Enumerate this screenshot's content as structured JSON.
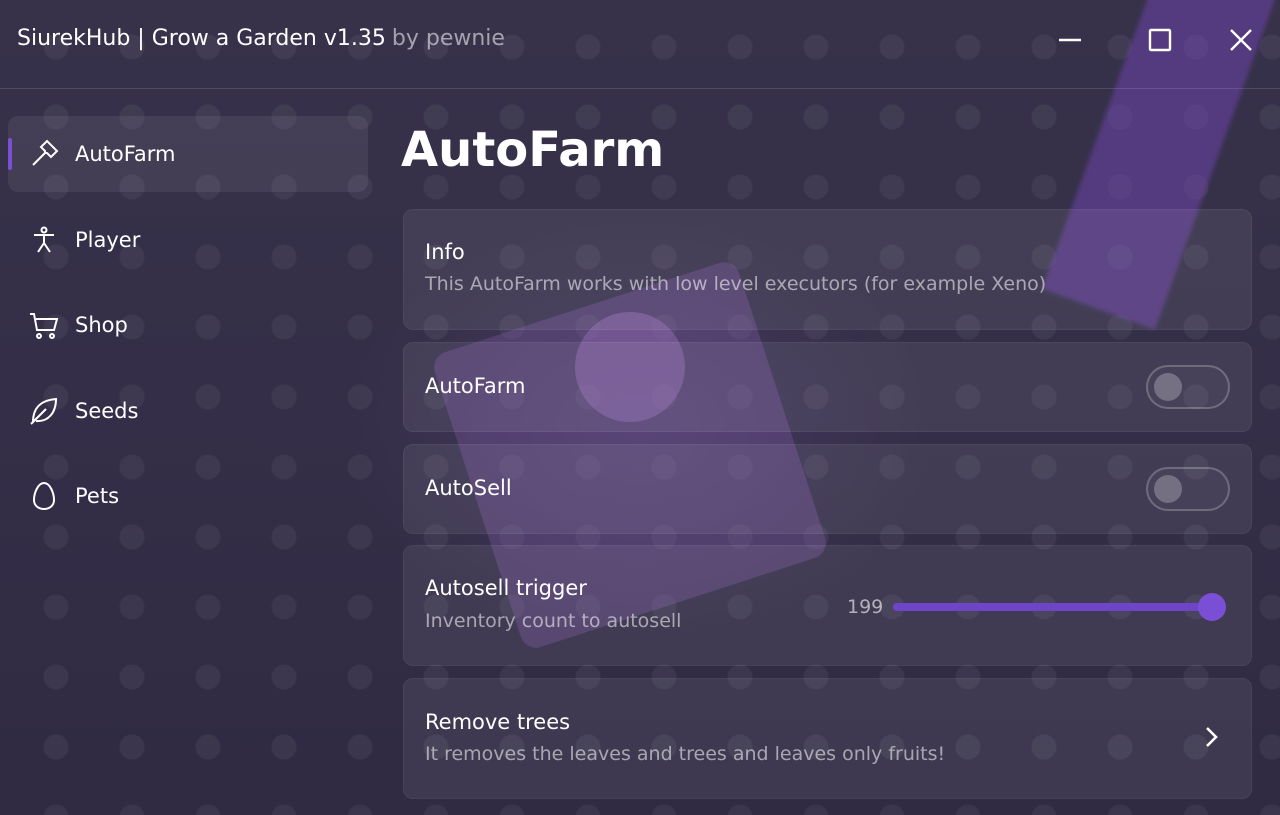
{
  "window": {
    "title": "SiurekHub | Grow a Garden v1.35",
    "author": "by pewnie",
    "controls": {
      "minimize_icon": "minimize-icon",
      "maximize_icon": "maximize-icon",
      "close_icon": "close-icon"
    }
  },
  "sidebar": {
    "items": [
      {
        "label": "AutoFarm",
        "icon": "hammer-icon",
        "active": true
      },
      {
        "label": "Player",
        "icon": "person-icon",
        "active": false
      },
      {
        "label": "Shop",
        "icon": "cart-icon",
        "active": false
      },
      {
        "label": "Seeds",
        "icon": "leaf-icon",
        "active": false
      },
      {
        "label": "Pets",
        "icon": "egg-icon",
        "active": false
      }
    ]
  },
  "main": {
    "title": "AutoFarm",
    "info": {
      "title": "Info",
      "description": "This AutoFarm works with low level executors (for example Xeno)"
    },
    "autofarm_toggle": {
      "label": "AutoFarm",
      "enabled": false
    },
    "autosell_toggle": {
      "label": "AutoSell",
      "enabled": false
    },
    "autosell_trigger": {
      "title": "Autosell trigger",
      "description": "Inventory count to autosell",
      "value": "199",
      "fill_fraction": 1.0
    },
    "remove_trees": {
      "title": "Remove trees",
      "description": "It removes the leaves and trees and leaves only fruits!"
    }
  },
  "colors": {
    "accent": "#7a4fd6",
    "background": "#3a3350"
  }
}
